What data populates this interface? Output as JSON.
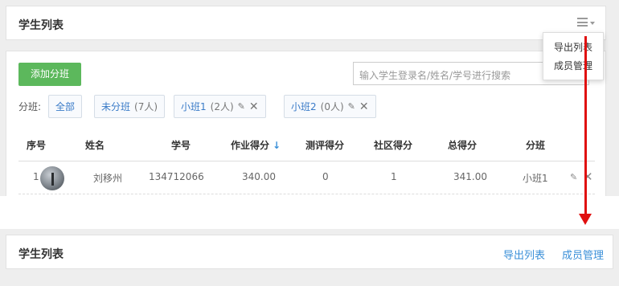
{
  "header": {
    "title": "学生列表",
    "menu_icon": "hamburger-icon"
  },
  "dropdown": {
    "items": [
      "导出列表",
      "成员管理"
    ]
  },
  "toolbar": {
    "add_class_label": "添加分班",
    "search_placeholder": "输入学生登录名/姓名/学号进行搜索"
  },
  "filter": {
    "label": "分班:",
    "chips": [
      {
        "name": "全部",
        "count": ""
      },
      {
        "name": "未分班",
        "count": "(7人)"
      },
      {
        "name": "小班1",
        "count": "(2人)"
      },
      {
        "name": "小班2",
        "count": "(0人)"
      }
    ]
  },
  "table": {
    "headers": [
      "序号",
      "姓名",
      "学号",
      "作业得分",
      "测评得分",
      "社区得分",
      "总得分",
      "分班"
    ],
    "sort_icon": "↓",
    "rows": [
      {
        "index": "1",
        "name": "刘移州",
        "student_id": "134712066",
        "homework": "340.00",
        "assessment": "0",
        "community": "1",
        "total": "341.00",
        "class": "小班1"
      }
    ]
  },
  "bottom": {
    "title": "学生列表",
    "links": [
      "导出列表",
      "成员管理"
    ]
  },
  "colors": {
    "primary_button": "#5cb85c",
    "link": "#3a8fd8",
    "annotation_arrow": "#e01010"
  }
}
